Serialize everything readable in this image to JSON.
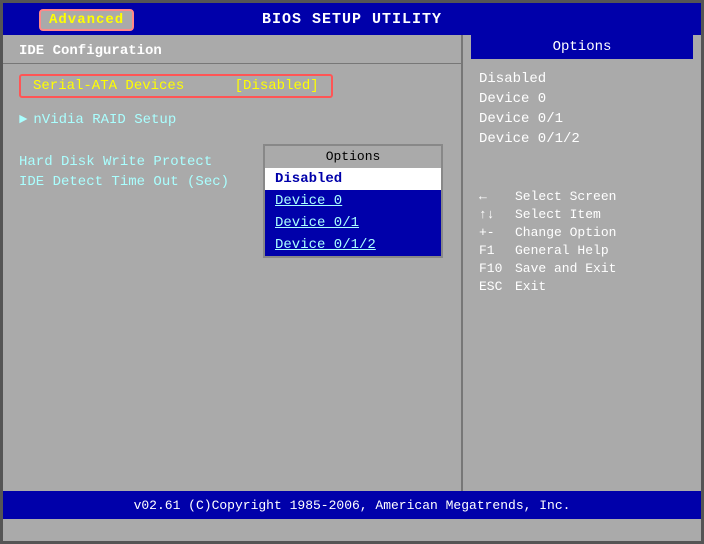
{
  "header": {
    "title": "BIOS SETUP UTILITY",
    "active_tab": "Advanced"
  },
  "left_panel": {
    "section_title": "IDE Configuration",
    "selected_item_label": "Serial-ATA Devices",
    "selected_item_value": "[Disabled]",
    "submenu_item": "nVidia RAID Setup",
    "plain_items": [
      "Hard Disk Write Protect",
      "IDE Detect Time Out (Sec)"
    ]
  },
  "popup": {
    "title": "Options",
    "items": [
      {
        "label": "Disabled",
        "selected": true
      },
      {
        "label": "Device 0",
        "selected": false,
        "underline": true
      },
      {
        "label": "Device 0/1",
        "selected": false,
        "underline": true
      },
      {
        "label": "Device 0/1/2",
        "selected": false,
        "underline": true
      }
    ]
  },
  "right_panel": {
    "options_header": "Options",
    "option_values": [
      "Disabled",
      "Device 0",
      "Device 0/1",
      "Device 0/1/2"
    ]
  },
  "help": {
    "lines": [
      {
        "key": "←",
        "desc": "Select Screen"
      },
      {
        "key": "↑↓",
        "desc": "Select Item"
      },
      {
        "key": "+-",
        "desc": "Change Option"
      },
      {
        "key": "F1",
        "desc": "General Help"
      },
      {
        "key": "F10",
        "desc": "Save and Exit"
      },
      {
        "key": "ESC",
        "desc": "Exit"
      }
    ]
  },
  "footer": {
    "text": "v02.61  (C)Copyright 1985-2006, American Megatrends, Inc."
  }
}
